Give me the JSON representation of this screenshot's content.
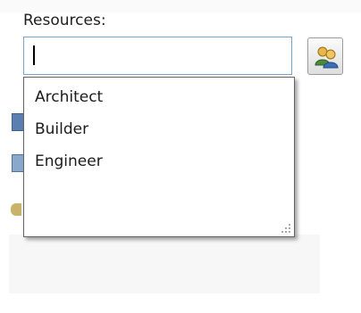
{
  "resources": {
    "label": "Resources:",
    "input_value": "",
    "lookup_icon": "people-lookup-icon"
  },
  "dropdown": {
    "options": [
      {
        "label": "Architect"
      },
      {
        "label": "Builder"
      },
      {
        "label": "Engineer"
      }
    ],
    "resize_icon": "resize-grip-icon"
  },
  "side_icons": [
    "calendar-icon",
    "calendar-icon",
    "person-icon"
  ],
  "colors": {
    "input_border": "#7ba3cf",
    "dropdown_border": "#646464",
    "text": "#1b1b1b"
  }
}
